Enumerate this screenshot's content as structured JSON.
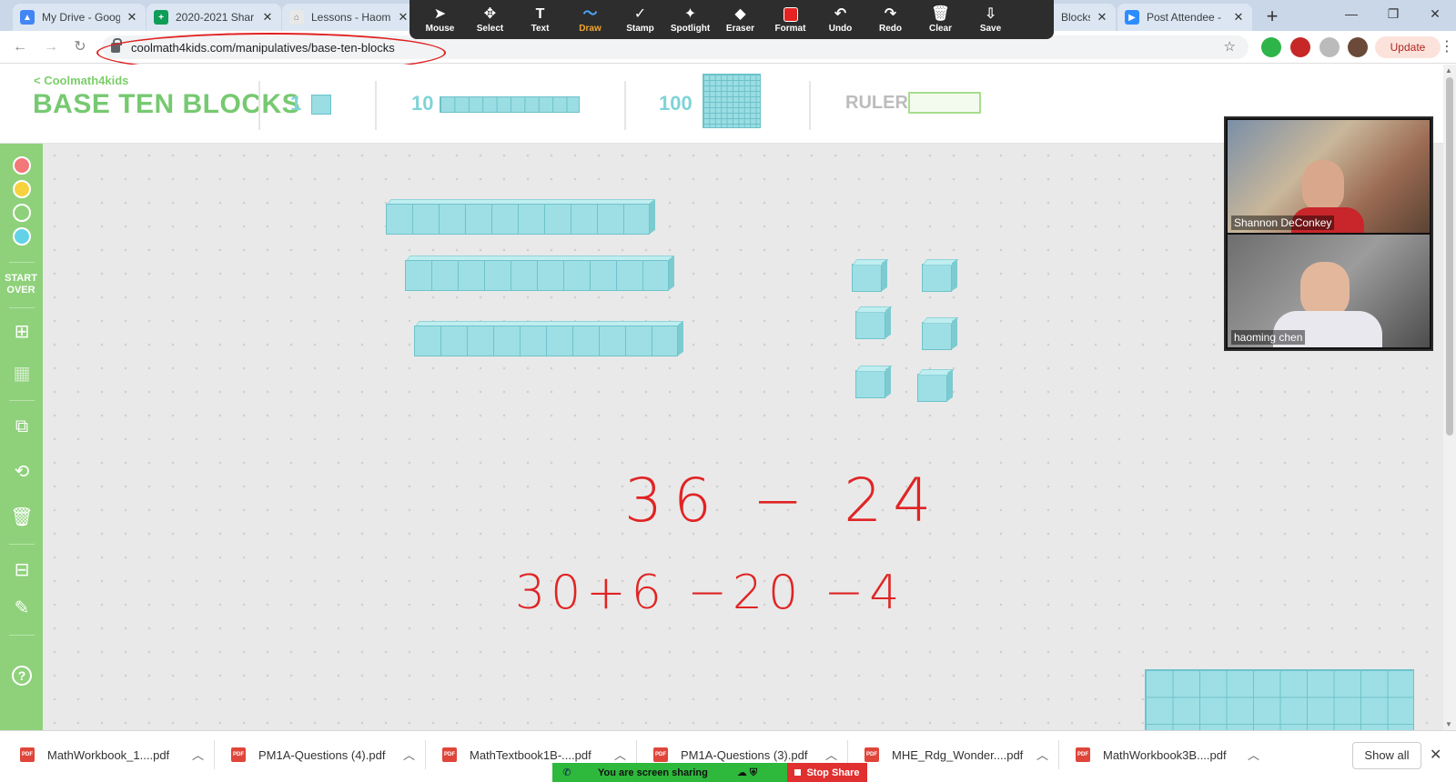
{
  "browser": {
    "tabs": [
      {
        "title": "My Drive - Goog",
        "fav_color": "#4285f4",
        "fav_text": "▲"
      },
      {
        "title": "2020-2021 Shar",
        "fav_color": "#0f9d58",
        "fav_text": "+"
      },
      {
        "title": "Lessons - Haom",
        "fav_color": "#f5f5f5",
        "fav_text": "⌂"
      },
      {
        "title": "Blocks",
        "fav_color": "#d93025",
        "fav_text": "✕"
      },
      {
        "title": "Post Attendee -",
        "fav_color": "#2d8cff",
        "fav_text": "▶"
      }
    ],
    "url": "coolmath4kids.com/manipulatives/base-ten-blocks",
    "update_label": "Update"
  },
  "zoom_toolbar": {
    "tools": [
      {
        "label": "Mouse",
        "icon": "➤"
      },
      {
        "label": "Select",
        "icon": "✥"
      },
      {
        "label": "Text",
        "icon": "T"
      },
      {
        "label": "Draw",
        "icon": "～"
      },
      {
        "label": "Stamp",
        "icon": "✓"
      },
      {
        "label": "Spotlight",
        "icon": "✦"
      },
      {
        "label": "Eraser",
        "icon": "◆"
      },
      {
        "label": "Format",
        "icon": ""
      },
      {
        "label": "Undo",
        "icon": "↶"
      },
      {
        "label": "Redo",
        "icon": "↷"
      },
      {
        "label": "Clear",
        "icon": "🗑"
      },
      {
        "label": "Save",
        "icon": "⇩"
      }
    ],
    "active_tool": "Draw",
    "format_color": "#e52323"
  },
  "page": {
    "brand": "< Coolmath4kids",
    "title": "BASE TEN BLOCKS",
    "palette": {
      "one_label": "1",
      "ten_label": "10",
      "hundred_label": "100",
      "ruler_label": "RULER"
    },
    "sidebar": {
      "colors": [
        "#f4777a",
        "#f7d23f",
        "#8ed17a",
        "#63d2e6"
      ],
      "start_over": "START OVER"
    }
  },
  "annotations": {
    "line1": "36 − 24",
    "line2": "30+6 −20 −4",
    "ink_color": "#e02424"
  },
  "video": {
    "participants": [
      {
        "name": "Shannon DeConkey"
      },
      {
        "name": "haoming chen"
      }
    ]
  },
  "downloads": {
    "files": [
      "MathWorkbook_1....pdf",
      "PM1A-Questions (4).pdf",
      "MathTextbook1B-....pdf",
      "PM1A-Questions (3).pdf",
      "MHE_Rdg_Wonder....pdf",
      "MathWorkbook3B....pdf"
    ],
    "show_all": "Show all"
  },
  "share_bar": {
    "message": "You are screen sharing",
    "stop_label": "Stop Share"
  }
}
